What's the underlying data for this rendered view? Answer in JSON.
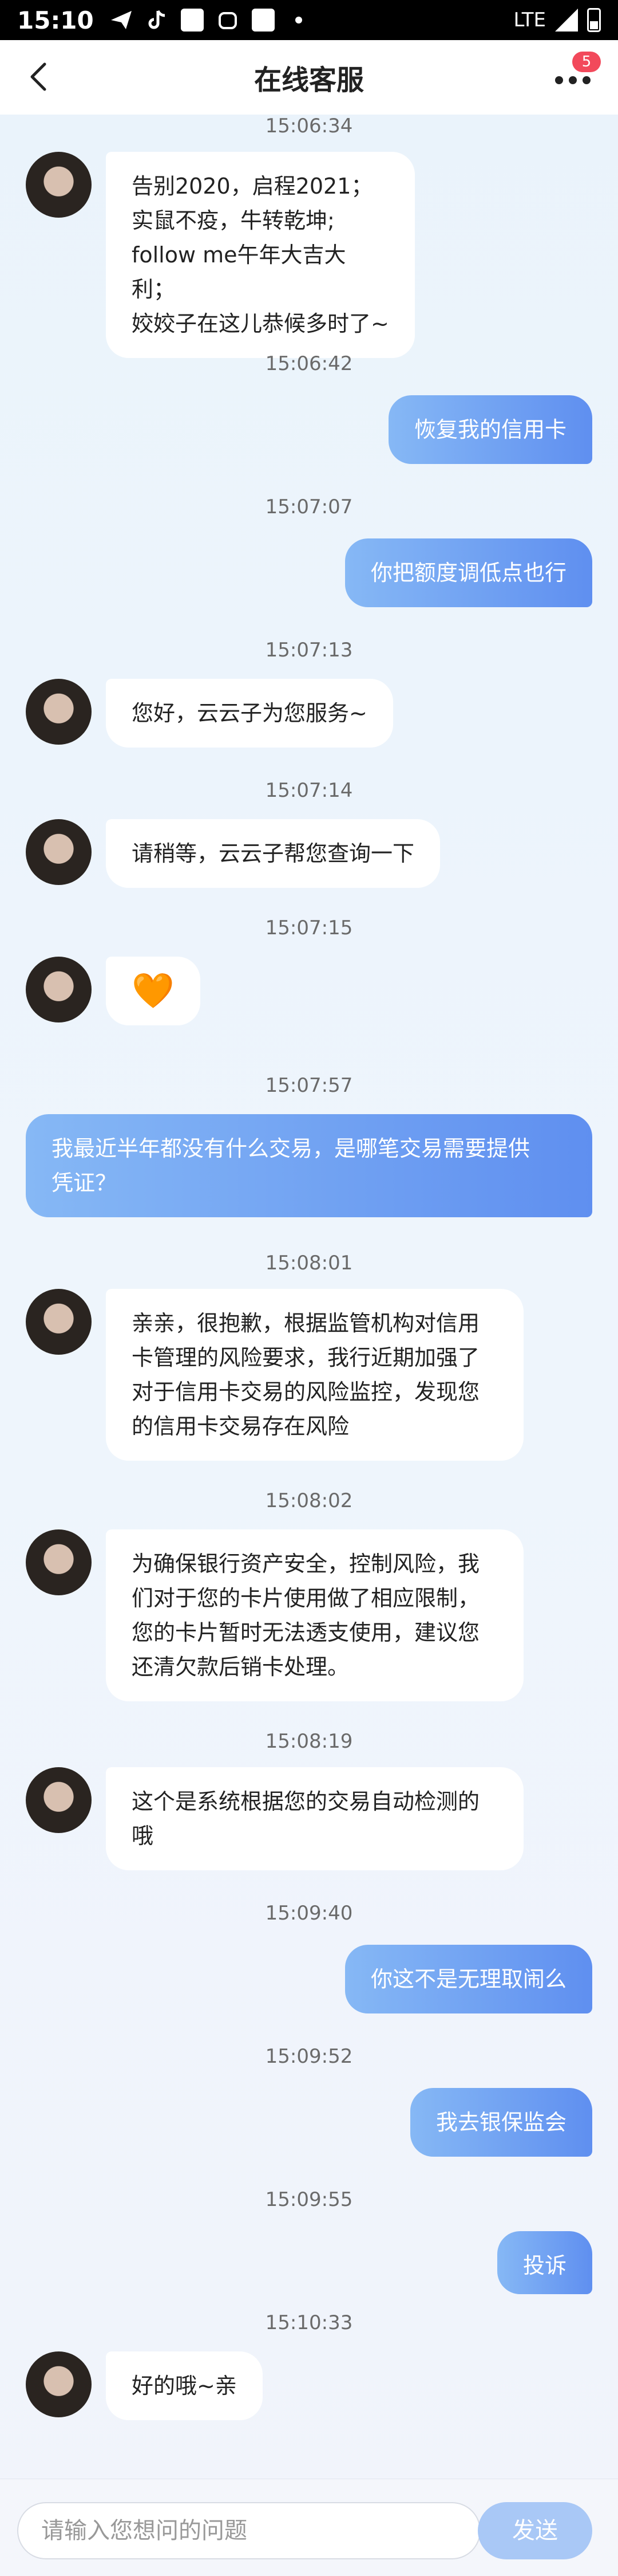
{
  "status_bar": {
    "time": "15:10",
    "network": "LTE"
  },
  "header": {
    "title": "在线客服",
    "badge": "5"
  },
  "messages": [
    {
      "time": "15:06:34",
      "side": "left",
      "lines": [
        "告别2020，启程2021；",
        "实鼠不疫，牛转乾坤;",
        "follow me午年大吉大利；",
        "姣姣子在这儿恭候多时了~"
      ]
    },
    {
      "time": "15:06:42",
      "side": "right",
      "lines": [
        "恢复我的信用卡"
      ]
    },
    {
      "time": "15:07:07",
      "side": "right",
      "lines": [
        "你把额度调低点也行"
      ]
    },
    {
      "time": "15:07:13",
      "side": "left",
      "lines": [
        "您好，云云子为您服务~"
      ]
    },
    {
      "time": "15:07:14",
      "side": "left",
      "lines": [
        "请稍等，云云子帮您查询一下"
      ]
    },
    {
      "time": "15:07:15",
      "side": "left",
      "lines": [
        "🧡"
      ]
    },
    {
      "time": "15:07:57",
      "side": "right",
      "lines": [
        "我最近半年都没有什么交易，是哪笔交易需要提供",
        "凭证？"
      ]
    },
    {
      "time": "15:08:01",
      "side": "left",
      "lines": [
        "亲亲，很抱歉，根据监管机构对信用",
        "卡管理的风险要求，我行近期加强了",
        "对于信用卡交易的风险监控，发现您",
        "的信用卡交易存在风险"
      ]
    },
    {
      "time": "15:08:02",
      "side": "left",
      "lines": [
        "为确保银行资产安全，控制风险，我",
        "们对于您的卡片使用做了相应限制，",
        "您的卡片暂时无法透支使用，建议您",
        "还清欠款后销卡处理。"
      ]
    },
    {
      "time": "15:08:19",
      "side": "left",
      "lines": [
        "这个是系统根据您的交易自动检测的",
        "哦"
      ]
    },
    {
      "time": "15:09:40",
      "side": "right",
      "lines": [
        "你这不是无理取闹么"
      ]
    },
    {
      "time": "15:09:52",
      "side": "right",
      "lines": [
        "我去银保监会"
      ]
    },
    {
      "time": "15:09:55",
      "side": "right",
      "lines": [
        "投诉"
      ]
    },
    {
      "time": "15:10:33",
      "side": "left",
      "lines": [
        "好的哦~亲"
      ]
    }
  ],
  "input_bar": {
    "placeholder": "请输入您想问的问题",
    "send_label": "发送"
  },
  "colors": {
    "bubble_right_start": "#86b8f5",
    "bubble_right_end": "#5f8ff0",
    "badge": "#f2495b",
    "send": "#a9c8f6"
  }
}
